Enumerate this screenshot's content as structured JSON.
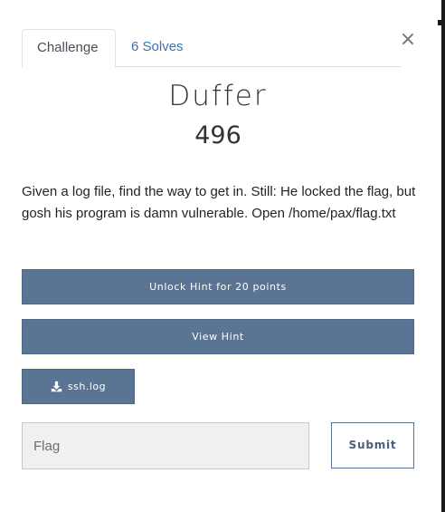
{
  "tabs": [
    {
      "label": "Challenge"
    },
    {
      "label": "6 Solves"
    }
  ],
  "close_label": "×",
  "challenge": {
    "name": "Duffer",
    "points": "496",
    "description": "Given a log file, find the way to get in. Still: He locked the flag, but gosh his program is damn vulnerable. Open /home/pax/flag.txt"
  },
  "hints": {
    "unlock_label": "Unlock Hint for 20 points",
    "view_label": "View Hint"
  },
  "file": {
    "label": "ssh.log",
    "icon": "download-icon"
  },
  "flag_form": {
    "placeholder": "Flag",
    "value": "",
    "submit_label": "Submit"
  },
  "colors": {
    "button_bg": "#5a7494",
    "tab_link": "#3c73b6"
  }
}
